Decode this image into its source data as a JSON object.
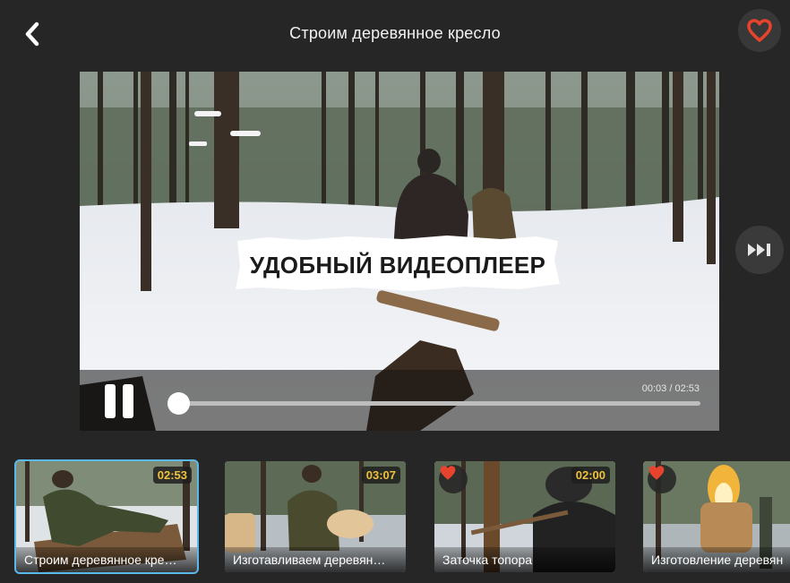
{
  "header": {
    "title": "Строим деревянное кресло",
    "back_icon": "chevron-left-icon",
    "favorite_icon": "heart-outline-icon",
    "favorite_color": "#e8432d"
  },
  "player": {
    "overlay_text": "УДОБНЫЙ ВИДЕОПЛЕЕР",
    "time_display": "00:03 / 02:53",
    "progress_fraction": 0.017,
    "state": "playing",
    "pause_icon": "pause-icon",
    "next_icon": "skip-next-icon"
  },
  "playlist": [
    {
      "title": "Строим деревянное кре…",
      "duration": "02:53",
      "favorite": false,
      "active": true
    },
    {
      "title": "Изготавливаем деревян…",
      "duration": "03:07",
      "favorite": false,
      "active": false
    },
    {
      "title": "Заточка топора",
      "duration": "02:00",
      "favorite": true,
      "active": false
    },
    {
      "title": "Изготовление деревян",
      "duration": "",
      "favorite": true,
      "active": false
    }
  ],
  "colors": {
    "background": "#262626",
    "accent_heart": "#e8432d",
    "duration_text": "#f0c23a",
    "active_outline": "#5bb8ea"
  }
}
